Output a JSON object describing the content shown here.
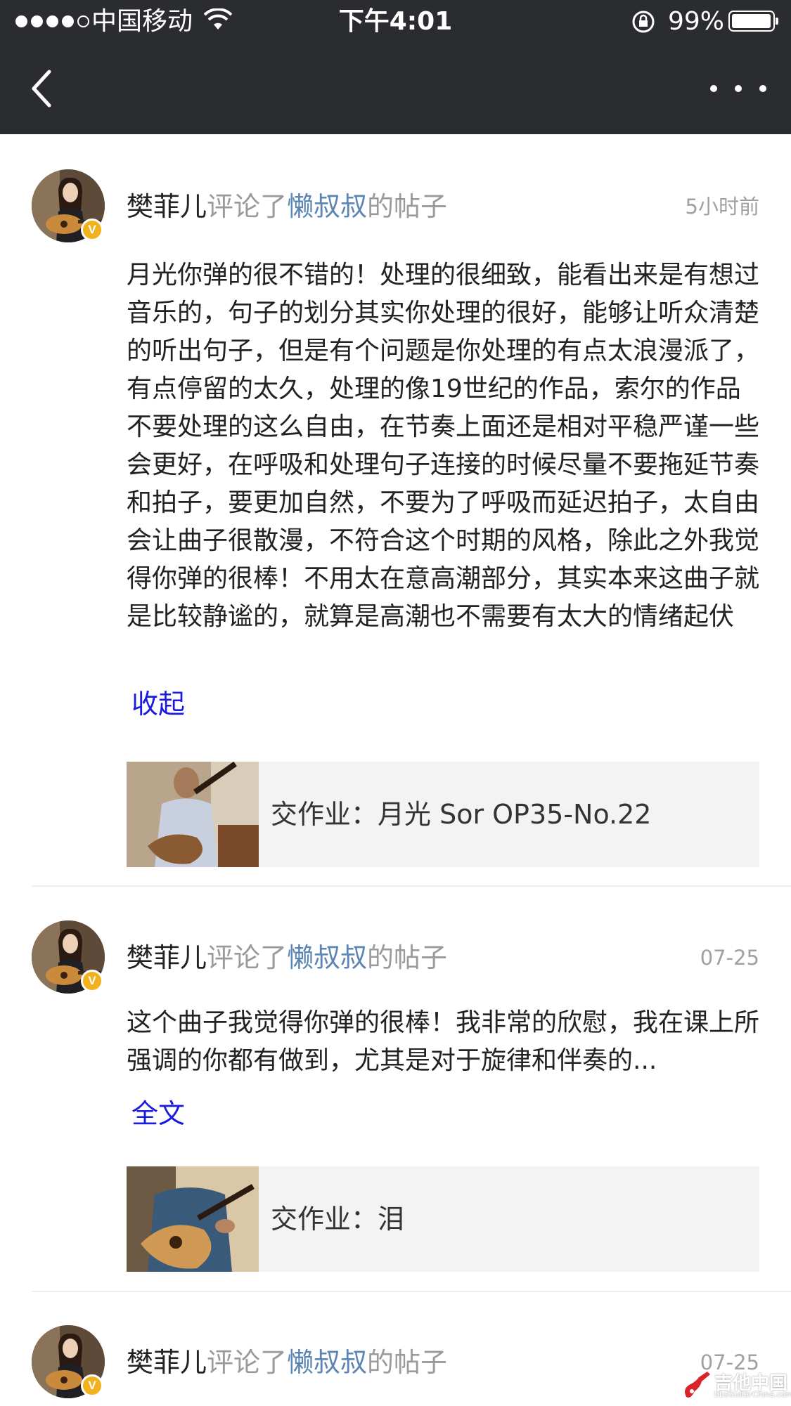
{
  "status_bar": {
    "carrier": "中国移动",
    "time": "下午4:01",
    "battery": "99%",
    "battery_level": 0.99
  },
  "nav": {
    "back_icon": "chevron-left-icon",
    "more_icon": "more-dots-icon"
  },
  "comments": [
    {
      "user": "樊菲儿",
      "action": "评论了",
      "target": "懒叔叔",
      "suffix": "的帖子",
      "time": "5小时前",
      "badge": "V",
      "text": "月光你弹的很不错的！处理的很细致，能看出来是有想过音乐的，句子的划分其实你处理的很好，能够让听众清楚的听出句子，但是有个问题是你处理的有点太浪漫派了，有点停留的太久，处理的像19世纪的作品，索尔的作品不要处理的这么自由，在节奏上面还是相对平稳严谨一些会更好，在呼吸和处理句子连接的时候尽量不要拖延节奏和拍子，要更加自然，不要为了呼吸而延迟拍子，太自由会让曲子很散漫，不符合这个时期的风格，除此之外我觉得你弹的很棒！不用太在意高潮部分，其实本来这曲子就是比较静谧的，就算是高潮也不需要有太大的情绪起伏",
      "toggle": "收起",
      "post_title": "交作业：月光 Sor OP35-No.22"
    },
    {
      "user": "樊菲儿",
      "action": "评论了",
      "target": "懒叔叔",
      "suffix": "的帖子",
      "time": "07-25",
      "badge": "V",
      "text": "这个曲子我觉得你弹的很棒！我非常的欣慰，我在课上所强调的你都有做到，尤其是对于旋律和伴奏的...",
      "toggle": "全文",
      "post_title": "交作业：泪"
    },
    {
      "user": "樊菲儿",
      "action": "评论了",
      "target": "懒叔叔",
      "suffix": "的帖子",
      "time": "07-25",
      "badge": "V"
    }
  ],
  "watermark": {
    "text": "吉他中国",
    "sub": "bbsGuitarChina.com"
  },
  "colors": {
    "nav_bg": "#2b2c30",
    "link_blue": "#5b85b3",
    "toggle_blue": "#1a1ae0",
    "card_bg": "#f3f3f3",
    "verified_badge": "#f2b21d"
  }
}
